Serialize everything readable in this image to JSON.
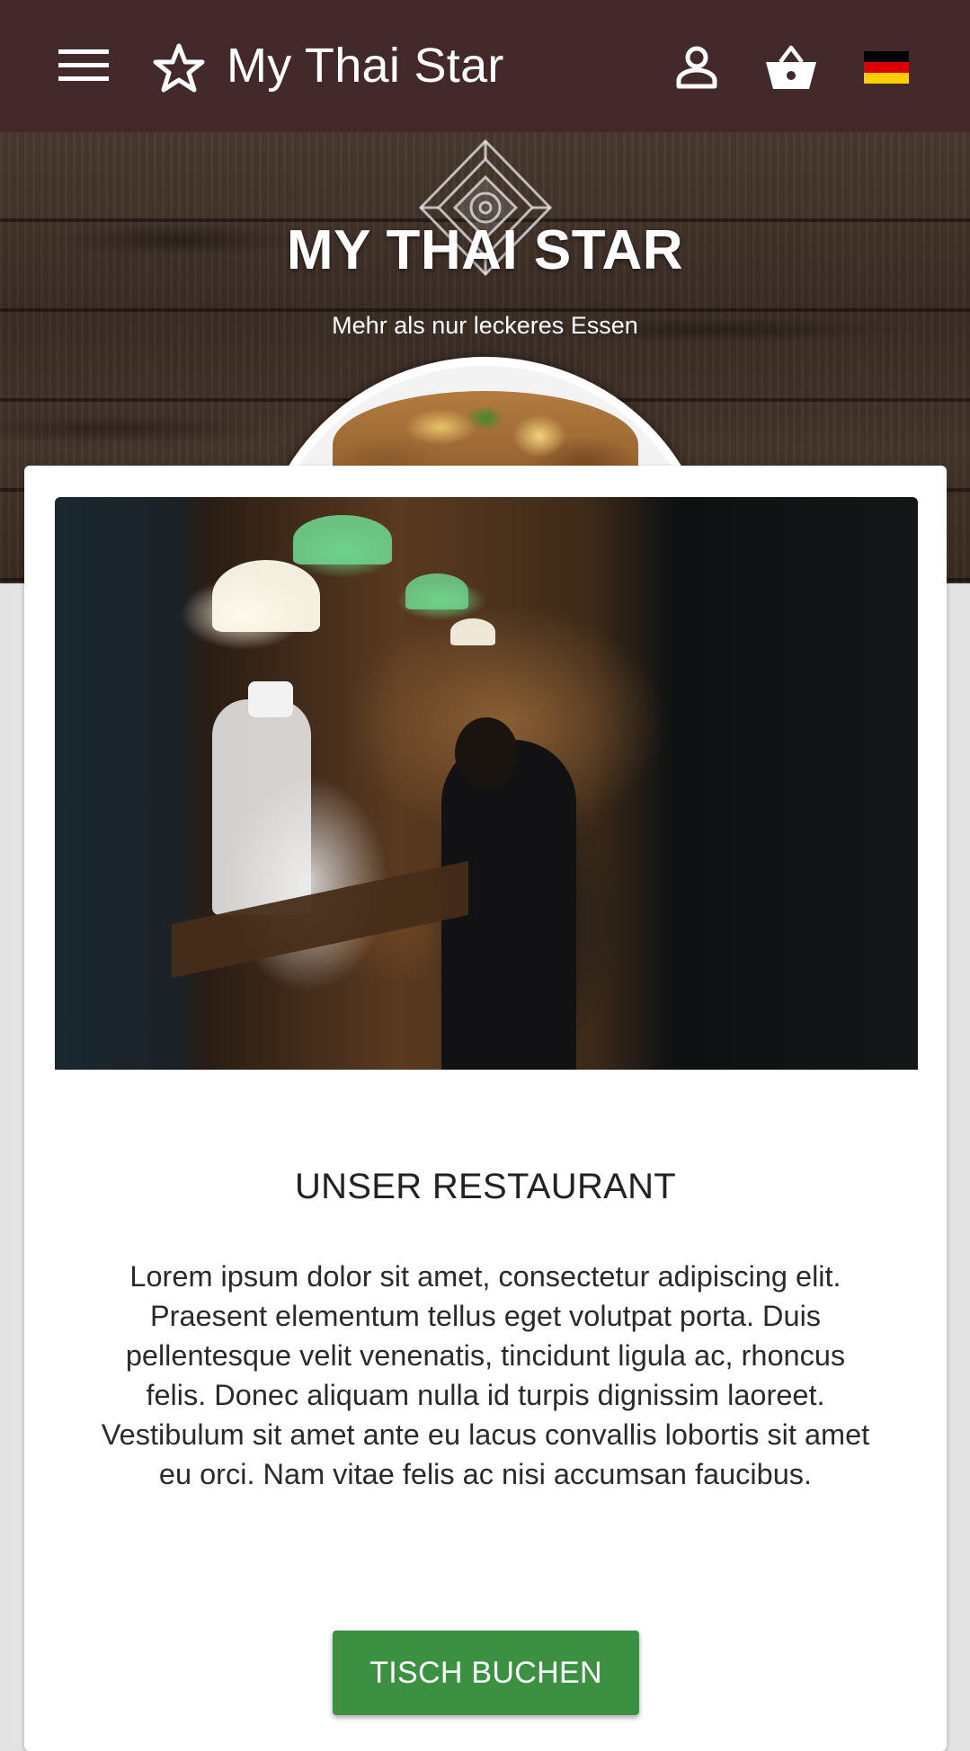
{
  "toolbar": {
    "title": "My Thai Star",
    "menu_icon": "hamburger-menu-icon",
    "logo_icon": "star-outline-icon",
    "user_icon": "account-icon",
    "cart_icon": "shopping-basket-icon",
    "language_icon": "german-flag-icon",
    "background_color": "#43292a"
  },
  "hero": {
    "brand": "MY THAI STAR",
    "slogan": "Mehr als nur leckeres Essen"
  },
  "card": {
    "headline": "UNSER RESTAURANT",
    "description": "Lorem ipsum dolor sit amet, consectetur adipiscing elit. Praesent elementum tellus eget volutpat porta. Duis pellentesque velit venenatis, tincidunt ligula ac, rhoncus felis. Donec aliquam nulla id turpis dignissim laoreet. Vestibulum sit amet ante eu lacus convallis lobortis sit amet eu orci. Nam vitae felis ac nisi accumsan faucibus.",
    "button_label": "TISCH BUCHEN",
    "button_color": "#3b9141"
  }
}
